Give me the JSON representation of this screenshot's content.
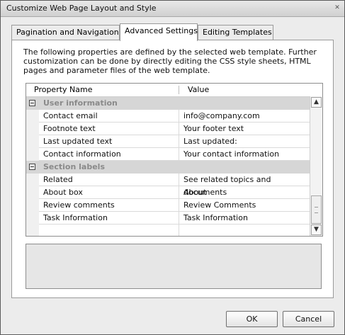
{
  "window": {
    "title": "Customize Web Page Layout and Style"
  },
  "tabs": [
    {
      "label": "Pagination and Navigation"
    },
    {
      "label": "Advanced Settings"
    },
    {
      "label": "Editing Templates"
    }
  ],
  "description": "The following properties are defined by the selected web template. Further customization can be done by directly editing the CSS style sheets, HTML pages and parameter files of the web template.",
  "grid": {
    "columns": {
      "name": "Property Name",
      "value": "Value"
    },
    "groups": [
      {
        "label": "User information",
        "rows": [
          {
            "name": "Contact email",
            "value": "info@company.com"
          },
          {
            "name": "Footnote text",
            "value": "Your footer text"
          },
          {
            "name": "Last updated text",
            "value": "Last updated:"
          },
          {
            "name": "Contact information",
            "value": "Your contact information"
          }
        ]
      },
      {
        "label": "Section labels",
        "rows": [
          {
            "name": "Related",
            "value": "See related topics and documents"
          },
          {
            "name": "About box",
            "value": "About"
          },
          {
            "name": "Review comments",
            "value": "Review Comments"
          },
          {
            "name": "Task Information",
            "value": "Task Information"
          }
        ]
      }
    ]
  },
  "buttons": {
    "ok": "OK",
    "cancel": "Cancel"
  }
}
